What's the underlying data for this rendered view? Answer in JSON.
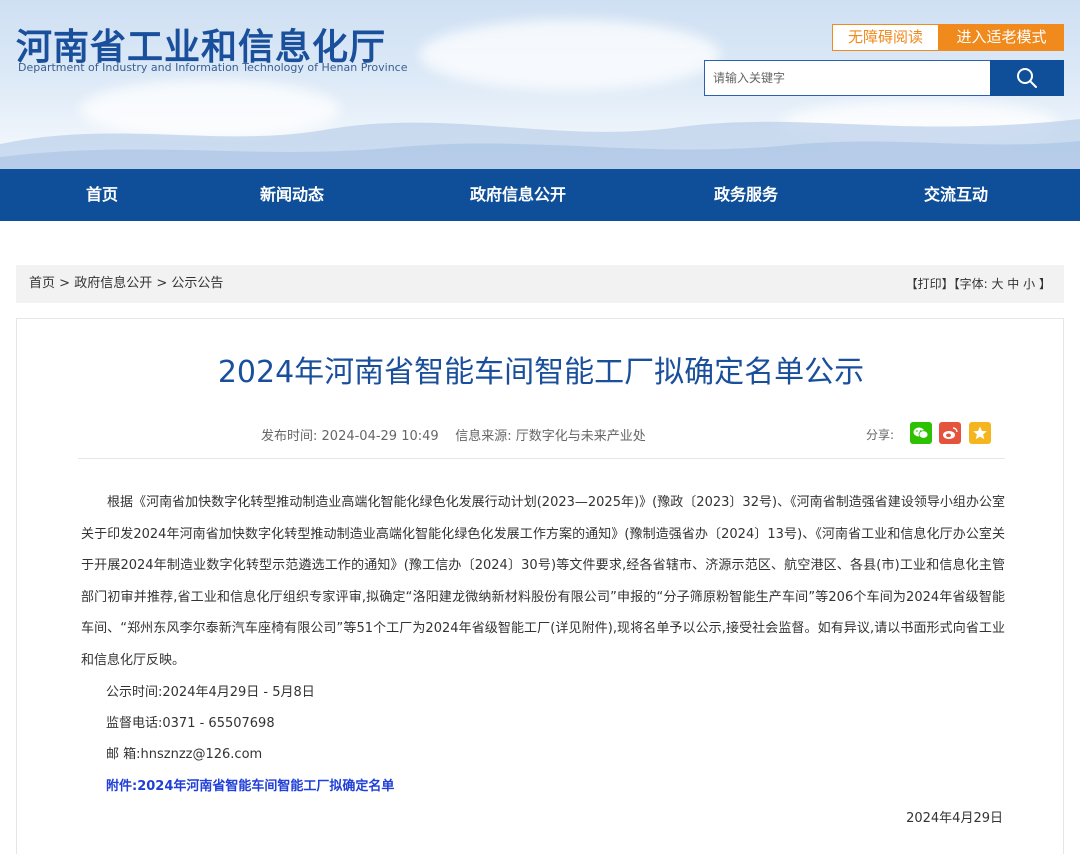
{
  "header": {
    "title_cn": "河南省工业和信息化厅",
    "title_en": "Department of Industry and Information Technology of Henan Province",
    "accessibility_label": "无障碍阅读",
    "elder_mode_label": "进入适老模式",
    "search_placeholder": "请输入关键字",
    "search_icon": "search-icon"
  },
  "nav": {
    "items": [
      {
        "label": "首页"
      },
      {
        "label": "新闻动态"
      },
      {
        "label": "政府信息公开"
      },
      {
        "label": "政务服务"
      },
      {
        "label": "交流互动"
      }
    ]
  },
  "breadcrumb": {
    "home": "首页",
    "sep": ">",
    "level1": "政府信息公开",
    "level2": "公示公告",
    "print": "【打印】",
    "font_label": "【字体:",
    "font_large": "大",
    "font_medium": "中",
    "font_small": "小",
    "font_end": "】"
  },
  "article": {
    "title": "2024年河南省智能车间智能工厂拟确定名单公示",
    "publish_label": "发布时间:",
    "publish_time": "2024-04-29 10:49",
    "source_label": "信息来源:",
    "source": "厅数字化与未来产业处",
    "share_label": "分享:",
    "share_icons": [
      "wechat-icon",
      "weibo-icon",
      "favorite-icon"
    ],
    "body": "根据《河南省加快数字化转型推动制造业高端化智能化绿色化发展行动计划(2023—2025年)》(豫政〔2023〕32号)、《河南省制造强省建设领导小组办公室关于印发2024年河南省加快数字化转型推动制造业高端化智能化绿色化发展工作方案的通知》(豫制造强省办〔2024〕13号)、《河南省工业和信息化厅办公室关于开展2024年制造业数字化转型示范遴选工作的通知》(豫工信办〔2024〕30号)等文件要求,经各省辖市、济源示范区、航空港区、各县(市)工业和信息化主管部门初审并推荐,省工业和信息化厅组织专家评审,拟确定“洛阳建龙微纳新材料股份有限公司”申报的“分子筛原粉智能生产车间”等206个车间为2024年省级智能车间、“郑州东风李尔泰新汽车座椅有限公司”等51个工厂为2024年省级智能工厂(详见附件),现将名单予以公示,接受社会监督。如有异议,请以书面形式向省工业和信息化厅反映。",
    "period": "公示时间:2024年4月29日 - 5月8日",
    "phone": "监督电话:0371 - 65507698",
    "email": "邮 箱:hnsznzz@126.com",
    "attachment": "附件:2024年河南省智能车间智能工厂拟确定名单",
    "date": "2024年4月29日"
  },
  "colors": {
    "brand_blue": "#0f4f9a",
    "title_blue": "#1a4f9c",
    "accent_orange": "#f08a1c",
    "wechat_green": "#2dc100",
    "weibo_red": "#e6533c",
    "favorite_gold": "#f5b51e",
    "attachment_blue": "#1f3fd8"
  }
}
